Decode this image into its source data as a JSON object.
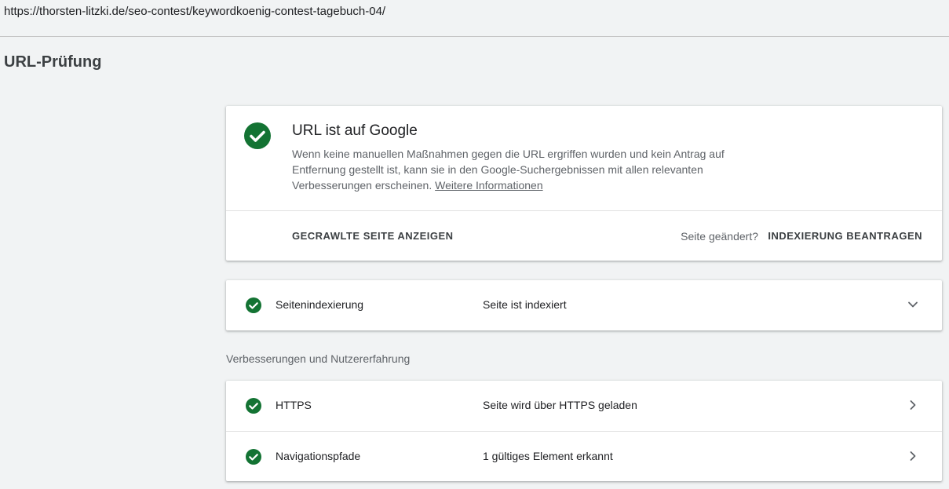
{
  "browser": {
    "url": "https://thorsten-litzki.de/seo-contest/keywordkoenig-contest-tagebuch-04/"
  },
  "page": {
    "title": "URL-Prüfung"
  },
  "status_card": {
    "icon": "check-circle-icon",
    "heading": "URL ist auf Google",
    "description": "Wenn keine manuellen Maßnahmen gegen die URL ergriffen wurden und kein Antrag auf Entfernung gestellt ist, kann sie in den Google-Suchergebnissen mit allen relevanten Verbesserungen erscheinen.",
    "more_link": "Weitere Informationen",
    "crawled_button": "GECRAWLTE SEITE ANZEIGEN",
    "changed_label": "Seite geändert?",
    "request_button": "INDEXIERUNG BEANTRAGEN"
  },
  "indexing": {
    "label": "Seitenindexierung",
    "value": "Seite ist indexiert",
    "icon": "check-circle-icon",
    "expand_icon": "chevron-down-icon"
  },
  "improvements": {
    "section_label": "Verbesserungen und Nutzererfahrung",
    "rows": [
      {
        "label": "HTTPS",
        "value": "Seite wird über HTTPS geladen",
        "icon": "check-circle-icon"
      },
      {
        "label": "Navigationspfade",
        "value": "1 gültiges Element erkannt",
        "icon": "check-circle-icon"
      }
    ]
  },
  "colors": {
    "success_green": "#137333",
    "background": "#f1f3f4",
    "card": "#ffffff",
    "muted_text": "#5f6368"
  }
}
